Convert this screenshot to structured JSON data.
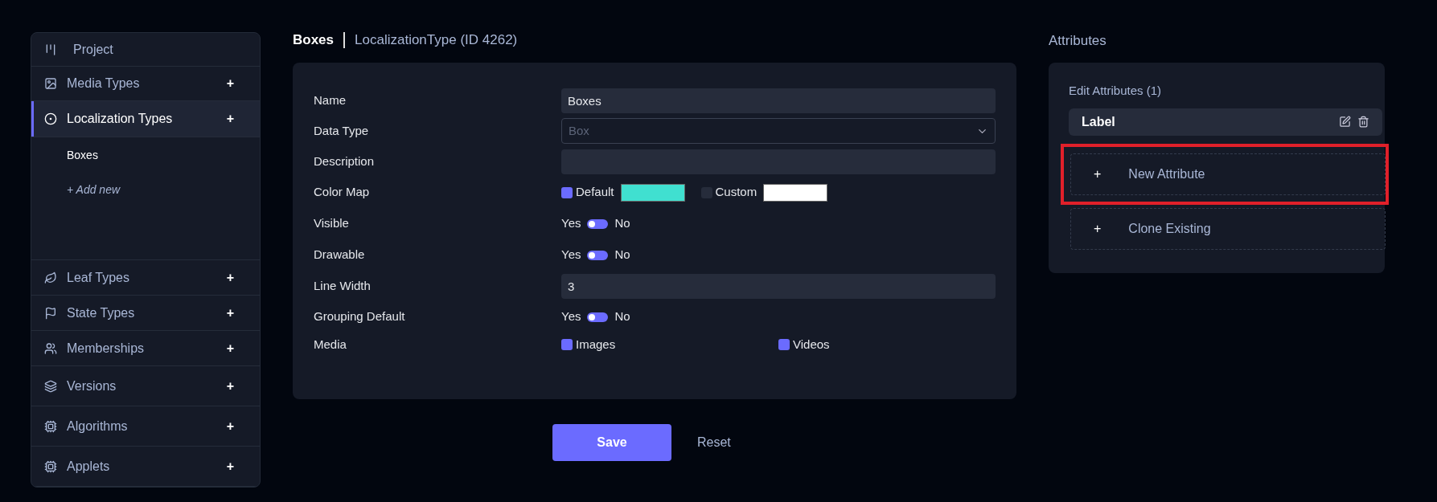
{
  "sidebar": {
    "items": [
      {
        "label": "Project",
        "selected": false,
        "add": false
      },
      {
        "label": "Media Types",
        "selected": false,
        "add": true
      },
      {
        "label": "Localization Types",
        "selected": true,
        "add": true,
        "children": [
          {
            "label": "Boxes",
            "kind": "item"
          },
          {
            "label": "+ Add new",
            "kind": "add"
          }
        ]
      },
      {
        "label": "Leaf Types",
        "selected": false,
        "add": true
      },
      {
        "label": "State Types",
        "selected": false,
        "add": true
      },
      {
        "label": "Memberships",
        "selected": false,
        "add": true
      },
      {
        "label": "Versions",
        "selected": false,
        "add": true
      },
      {
        "label": "Algorithms",
        "selected": false,
        "add": true
      },
      {
        "label": "Applets",
        "selected": false,
        "add": true
      }
    ]
  },
  "add_sign": "+",
  "header": {
    "title": "Boxes",
    "subtitle": "LocalizationType (ID 4262)"
  },
  "form": [
    {
      "kind": "text",
      "label": "Name",
      "value": "Boxes"
    },
    {
      "kind": "select",
      "label": "Data Type",
      "value": "Box",
      "disabled": true
    },
    {
      "kind": "text",
      "label": "Description"
    },
    {
      "kind": "colormap",
      "label": "Color Map",
      "options": [
        {
          "label": "Default",
          "checked": true,
          "color": "#40e0d0"
        },
        {
          "label": "Custom",
          "checked": false,
          "color": "#ffffff"
        }
      ]
    },
    {
      "kind": "toggle",
      "label": "Visible",
      "yes": "Yes",
      "no": "No",
      "on": false
    },
    {
      "kind": "toggle",
      "label": "Drawable",
      "yes": "Yes",
      "no": "No",
      "on": false
    },
    {
      "kind": "text",
      "label": "Line Width",
      "value": "3"
    },
    {
      "kind": "toggle",
      "label": "Grouping Default",
      "yes": "Yes",
      "no": "No",
      "on": false
    },
    {
      "kind": "checks",
      "label": "Media",
      "options": [
        {
          "label": "Images",
          "checked": true
        },
        {
          "label": "Videos",
          "checked": true
        }
      ]
    }
  ],
  "buttons": {
    "save": "Save",
    "reset": "Reset"
  },
  "attributes": {
    "title": "Attributes",
    "subtitle": "Edit Attributes (1)",
    "items": [
      "Label"
    ],
    "actions": [
      {
        "icon": "+",
        "label": "New Attribute",
        "highlighted": true
      },
      {
        "icon": "+",
        "label": "Clone Existing",
        "highlighted": false
      }
    ]
  }
}
